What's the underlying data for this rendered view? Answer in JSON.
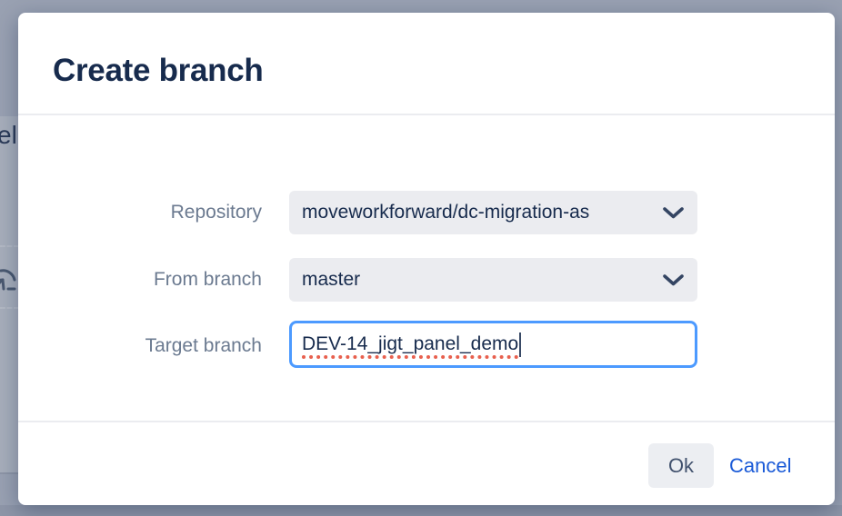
{
  "backdrop": {
    "clipped_text": "el"
  },
  "modal": {
    "title": "Create branch",
    "fields": [
      {
        "label": "Repository",
        "value": "moveworkforward/dc-migration-as",
        "type": "select"
      },
      {
        "label": "From branch",
        "value": "master",
        "type": "select"
      },
      {
        "label": "Target branch",
        "value": "DEV-14_jigt_panel_demo",
        "type": "text",
        "focused": true,
        "spellcheck_flagged": true
      }
    ],
    "footer": {
      "ok": "Ok",
      "cancel": "Cancel"
    }
  },
  "icons": {
    "chevron_down": "chevron-down",
    "curved_arrow": "curved-arrow",
    "text_cursor": "text-cursor"
  },
  "colors": {
    "overlay": "#99a1b2",
    "title_text": "#172b4d",
    "label_text": "#6b7a90",
    "field_bg": "#ebecf0",
    "field_text": "#172b4d",
    "focus_border": "#4c9aff",
    "spellcheck_underline": "#e8604e",
    "link": "#1a5ad7",
    "ok_button_bg": "#eceef2",
    "ok_button_text": "#42526e",
    "divider": "#ebecf0"
  }
}
